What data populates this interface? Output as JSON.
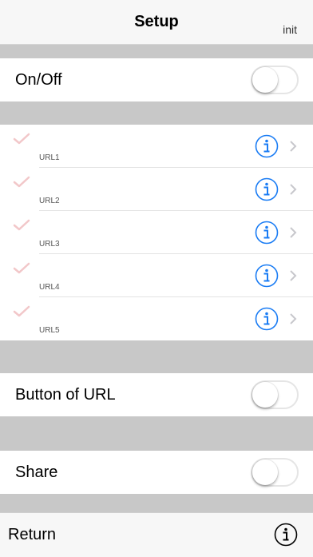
{
  "header": {
    "title": "Setup",
    "init_label": "init"
  },
  "onoff": {
    "label": "On/Off",
    "toggle_on": false
  },
  "url_list": [
    {
      "label": "URL1",
      "checked": true
    },
    {
      "label": "URL2",
      "checked": true
    },
    {
      "label": "URL3",
      "checked": true
    },
    {
      "label": "URL4",
      "checked": true
    },
    {
      "label": "URL5",
      "checked": true
    }
  ],
  "button_of_url": {
    "label": "Button of URL",
    "toggle_on": false
  },
  "share": {
    "label": "Share",
    "toggle_on": false
  },
  "footer": {
    "return_label": "Return"
  },
  "colors": {
    "check": "#f2c7c9",
    "info_blue": "#1a7cf4",
    "chevron": "#c7c7cc",
    "background_gray": "#c8c8c8"
  },
  "icons": {
    "check": "checkmark-icon",
    "info": "info-circle-icon",
    "chevron": "chevron-right-icon",
    "footer_info": "info-circle-icon"
  }
}
